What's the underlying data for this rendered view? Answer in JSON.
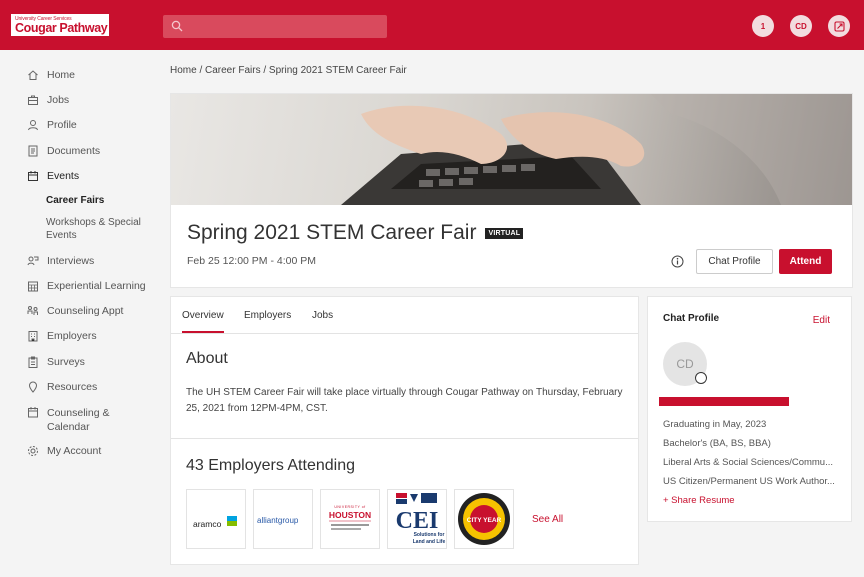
{
  "topbar": {
    "logo_sub": "University Career Services",
    "logo_main": "Cougar Pathway",
    "notification_count": "1",
    "user_initials": "CD"
  },
  "sidebar": {
    "items": [
      {
        "label": "Home",
        "icon": "home-icon"
      },
      {
        "label": "Jobs",
        "icon": "briefcase-icon"
      },
      {
        "label": "Profile",
        "icon": "user-icon"
      },
      {
        "label": "Documents",
        "icon": "document-icon"
      },
      {
        "label": "Events",
        "icon": "calendar-icon"
      },
      {
        "label": "Interviews",
        "icon": "interview-icon"
      },
      {
        "label": "Experiential Learning",
        "icon": "calendar-grid-icon"
      },
      {
        "label": "Counseling Appt",
        "icon": "counseling-icon"
      },
      {
        "label": "Employers",
        "icon": "building-icon"
      },
      {
        "label": "Surveys",
        "icon": "clipboard-icon"
      },
      {
        "label": "Resources",
        "icon": "pin-icon"
      },
      {
        "label": "Counseling & Calendar",
        "icon": "calendar-outline-icon"
      },
      {
        "label": "My Account",
        "icon": "gear-icon"
      }
    ],
    "subitems": [
      {
        "label": "Career Fairs",
        "active": true
      },
      {
        "label": "Workshops & Special Events",
        "active": false
      }
    ]
  },
  "breadcrumb": "Home / Career Fairs / Spring 2021 STEM Career Fair",
  "event": {
    "title": "Spring 2021 STEM Career Fair",
    "badge": "VIRTUAL",
    "date": "Feb 25 12:00 PM - 4:00 PM",
    "chat_profile_label": "Chat Profile",
    "attend_label": "Attend"
  },
  "tabs": [
    "Overview",
    "Employers",
    "Jobs"
  ],
  "about": {
    "title": "About",
    "text": "The UH STEM Career Fair will take place virtually through Cougar Pathway on Thursday, February 25, 2021 from 12PM-4PM, CST."
  },
  "employers": {
    "title": "43 Employers Attending",
    "logos": [
      {
        "name": "aramco"
      },
      {
        "name": "alliantgroup"
      },
      {
        "name": "University of Houston"
      },
      {
        "name": "CEI"
      },
      {
        "name": "City Year"
      }
    ],
    "see_all": "See All"
  },
  "chat_profile": {
    "title": "Chat Profile",
    "edit": "Edit",
    "initials": "CD",
    "lines": [
      "Graduating in May, 2023",
      "Bachelor's (BA, BS, BBA)",
      "Liberal Arts & Social Sciences/Commu...",
      "US Citizen/Permanent US Work Author..."
    ],
    "share_resume": "+ Share Resume"
  },
  "colors": {
    "brand": "#c8102e"
  }
}
